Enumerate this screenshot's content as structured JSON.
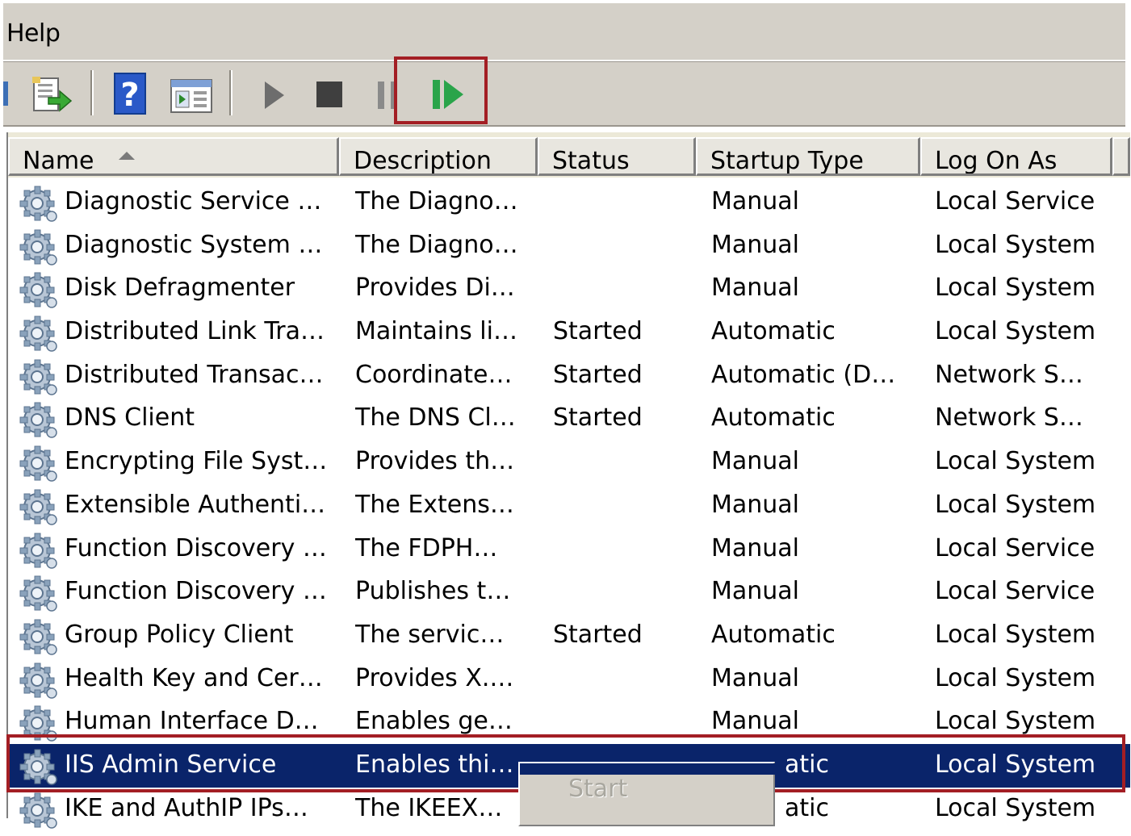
{
  "menubar": {
    "help_label": "Help"
  },
  "toolbar": {
    "buttons": [
      "export-list",
      "help",
      "properties-view",
      "start-service",
      "stop-service",
      "pause-service",
      "resume-service"
    ]
  },
  "columns": {
    "name": "Name",
    "description": "Description",
    "status": "Status",
    "startup_type": "Startup Type",
    "log_on_as": "Log On As"
  },
  "rows": [
    {
      "name": "Diagnostic Service …",
      "description": "The Diagno…",
      "status": "",
      "startup": "Manual",
      "logon": "Local Service"
    },
    {
      "name": "Diagnostic System …",
      "description": "The Diagno…",
      "status": "",
      "startup": "Manual",
      "logon": "Local System"
    },
    {
      "name": "Disk Defragmenter",
      "description": "Provides Di…",
      "status": "",
      "startup": "Manual",
      "logon": "Local System"
    },
    {
      "name": "Distributed Link Tra…",
      "description": "Maintains li…",
      "status": "Started",
      "startup": "Automatic",
      "logon": "Local System"
    },
    {
      "name": "Distributed Transac…",
      "description": "Coordinate…",
      "status": "Started",
      "startup": "Automatic (D…",
      "logon": "Network S…"
    },
    {
      "name": "DNS Client",
      "description": "The DNS Cl…",
      "status": "Started",
      "startup": "Automatic",
      "logon": "Network S…"
    },
    {
      "name": "Encrypting File Syst…",
      "description": "Provides th…",
      "status": "",
      "startup": "Manual",
      "logon": "Local System"
    },
    {
      "name": "Extensible Authenti…",
      "description": "The Extens…",
      "status": "",
      "startup": "Manual",
      "logon": "Local System"
    },
    {
      "name": "Function Discovery …",
      "description": "The FDPH…",
      "status": "",
      "startup": "Manual",
      "logon": "Local Service"
    },
    {
      "name": "Function Discovery …",
      "description": "Publishes t…",
      "status": "",
      "startup": "Manual",
      "logon": "Local Service"
    },
    {
      "name": "Group Policy Client",
      "description": "The servic…",
      "status": "Started",
      "startup": "Automatic",
      "logon": "Local System"
    },
    {
      "name": "Health Key and Cer…",
      "description": "Provides X.…",
      "status": "",
      "startup": "Manual",
      "logon": "Local System"
    },
    {
      "name": "Human Interface D…",
      "description": "Enables ge…",
      "status": "",
      "startup": "Manual",
      "logon": "Local System"
    },
    {
      "name": "IIS Admin Service",
      "description": "Enables thi…",
      "status": "",
      "startup": "atic",
      "logon": "Local System"
    },
    {
      "name": "IKE and AuthIP IPs…",
      "description": "The IKEEX…",
      "status": "",
      "startup": "atic",
      "logon": "Local System"
    }
  ],
  "context_menu": {
    "start_label": "Start"
  },
  "colors": {
    "selection": "#0a246a",
    "highlight_frame": "#a31e24",
    "chrome": "#d4d0c8"
  }
}
